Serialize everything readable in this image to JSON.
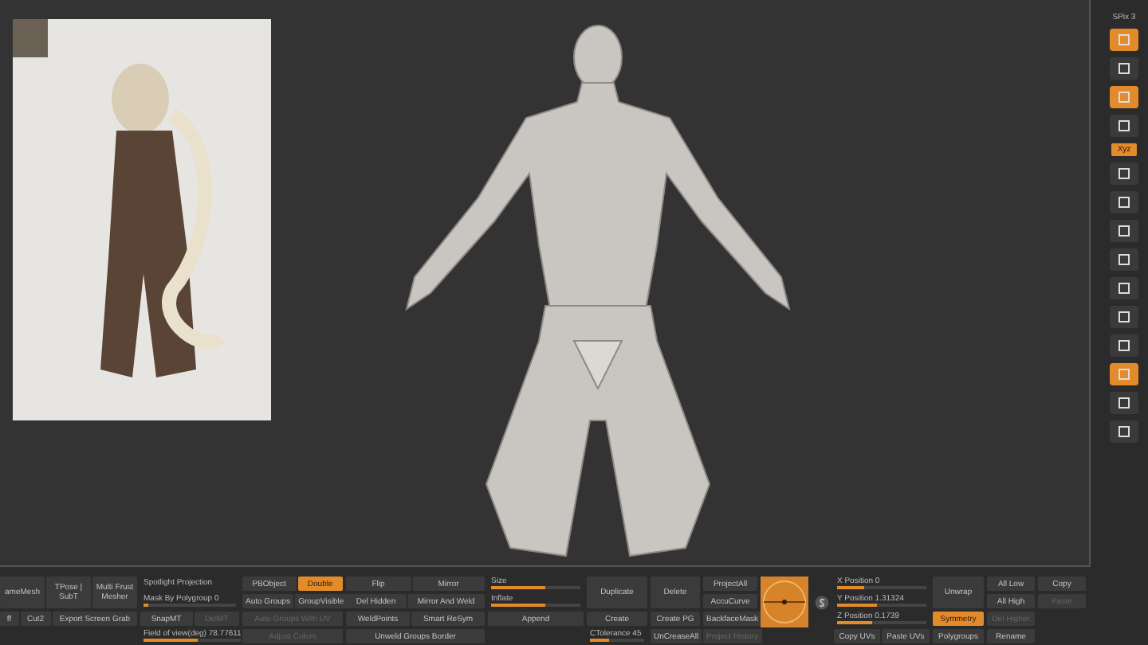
{
  "right_toolbar": [
    {
      "kind": "text",
      "label": "SPix 3"
    },
    {
      "kind": "icon",
      "on": true
    },
    {
      "kind": "icon",
      "on": false
    },
    {
      "kind": "icon",
      "on": true
    },
    {
      "kind": "icon",
      "on": false
    },
    {
      "kind": "text_button",
      "label": "Xyz",
      "on": true
    },
    {
      "kind": "icon",
      "on": false
    },
    {
      "kind": "icon",
      "on": false
    },
    {
      "kind": "icon",
      "on": false
    },
    {
      "kind": "icon",
      "on": false
    },
    {
      "kind": "icon",
      "on": false
    },
    {
      "kind": "icon",
      "on": false
    },
    {
      "kind": "icon",
      "on": false
    },
    {
      "kind": "icon",
      "on": true
    },
    {
      "kind": "icon",
      "on": false
    },
    {
      "kind": "icon",
      "on": false
    }
  ],
  "bottom_panel": {
    "columns": [
      {
        "lines": [
          [
            {
              "kind": "big",
              "label": "ameMesh",
              "on": false,
              "disabled": false
            },
            {
              "kind": "big",
              "label": "TPose | SubT",
              "on": false,
              "disabled": false
            },
            {
              "kind": "big",
              "label": "Multi Frust Mesher",
              "on": false,
              "disabled": false
            }
          ],
          [
            {
              "kind": "button",
              "label": "ff",
              "on": false,
              "disabled": false
            },
            {
              "kind": "button",
              "label": "Cut2",
              "on": false,
              "disabled": false
            },
            {
              "kind": "button",
              "label": "Export Screen Grab",
              "on": false,
              "disabled": false
            }
          ]
        ]
      },
      {
        "lines": [
          [
            {
              "kind": "text",
              "label": "Spotlight Projection"
            }
          ],
          [
            {
              "kind": "slider",
              "label": "Mask By Polygroup 0",
              "level": 0.05
            }
          ],
          [
            {
              "kind": "button",
              "label": "SnapMT",
              "on": false,
              "disabled": false
            },
            {
              "kind": "button",
              "label": "DelMT",
              "on": false,
              "disabled": true
            }
          ],
          [
            {
              "kind": "slider",
              "label": "Field of view(deg) 78.77611",
              "level": 0.55
            }
          ]
        ]
      },
      {
        "lines": [
          [
            {
              "kind": "button",
              "label": "PBObject",
              "on": false,
              "disabled": false
            },
            {
              "kind": "button",
              "label": "Double",
              "on": true,
              "disabled": false
            }
          ],
          [
            {
              "kind": "button",
              "label": "Auto Groups",
              "on": false,
              "disabled": false
            },
            {
              "kind": "button",
              "label": "GroupVisible",
              "on": false,
              "disabled": false
            }
          ],
          [
            {
              "kind": "button",
              "label": "Auto Groups With UV",
              "on": false,
              "disabled": true
            }
          ],
          [
            {
              "kind": "button",
              "label": "Adjust Colors",
              "on": false,
              "disabled": true
            }
          ]
        ]
      },
      {
        "lines": [
          [
            {
              "kind": "button",
              "label": "Flip",
              "on": false,
              "disabled": false
            },
            {
              "kind": "button",
              "label": "Mirror",
              "on": false,
              "disabled": false
            }
          ],
          [
            {
              "kind": "button",
              "label": "Del Hidden",
              "on": false,
              "disabled": false
            },
            {
              "kind": "button",
              "label": "Mirror And Weld",
              "on": false,
              "disabled": false
            }
          ],
          [
            {
              "kind": "button",
              "label": "WeldPoints",
              "on": false,
              "disabled": false
            },
            {
              "kind": "button",
              "label": "Smart ReSym",
              "on": false,
              "disabled": false
            }
          ],
          [
            {
              "kind": "button",
              "label": "Unweld Groups Border",
              "on": false,
              "disabled": false
            }
          ]
        ]
      },
      {
        "lines": [
          [
            {
              "kind": "slider",
              "label": "Size",
              "level": 0.6
            }
          ],
          [
            {
              "kind": "slider",
              "label": "Inflate",
              "level": 0.6
            }
          ],
          [
            {
              "kind": "button",
              "label": "Append",
              "on": false,
              "disabled": false
            }
          ]
        ]
      },
      {
        "lines": [
          [
            {
              "kind": "big",
              "label": "Duplicate",
              "on": false,
              "disabled": false
            }
          ],
          [
            {
              "kind": "button",
              "label": "Create",
              "on": false,
              "disabled": false
            }
          ],
          [
            {
              "kind": "slider",
              "label": "CTolerance 45",
              "level": 0.35
            }
          ]
        ]
      },
      {
        "lines": [
          [
            {
              "kind": "big",
              "label": "Delete",
              "on": false,
              "disabled": false
            }
          ],
          [
            {
              "kind": "button",
              "label": "Create PG",
              "on": false,
              "disabled": false
            }
          ],
          [
            {
              "kind": "button",
              "label": "UnCreaseAll",
              "on": false,
              "disabled": false
            }
          ]
        ]
      },
      {
        "lines": [
          [
            {
              "kind": "button",
              "label": "ProjectAll",
              "on": false,
              "disabled": false
            }
          ],
          [
            {
              "kind": "button",
              "label": "AccuCurve",
              "on": false,
              "disabled": false
            }
          ],
          [
            {
              "kind": "button",
              "label": "BackfaceMask",
              "on": false,
              "disabled": false
            }
          ],
          [
            {
              "kind": "button",
              "label": "Project History",
              "on": false,
              "disabled": true
            }
          ]
        ]
      },
      {
        "lines": [
          [
            {
              "kind": "gizmo"
            }
          ]
        ]
      },
      {
        "lines": [
          [
            {
              "kind": "slider",
              "label": "X Position 0",
              "level": 0.3
            }
          ],
          [
            {
              "kind": "slider",
              "label": "Y Position 1.31324",
              "level": 0.45
            }
          ],
          [
            {
              "kind": "slider",
              "label": "Z Position 0.1739",
              "level": 0.4
            }
          ],
          [
            {
              "kind": "button",
              "label": "Copy UVs",
              "on": false,
              "disabled": false
            },
            {
              "kind": "button",
              "label": "Paste UVs",
              "on": false,
              "disabled": false
            }
          ]
        ]
      },
      {
        "lines": [
          [
            {
              "kind": "big",
              "label": "Unwrap",
              "on": false,
              "disabled": false
            }
          ],
          [
            {
              "kind": "button",
              "label": "Symmetry",
              "on": true,
              "disabled": false
            }
          ],
          [
            {
              "kind": "button",
              "label": "Polygroups",
              "on": false,
              "disabled": false
            }
          ]
        ]
      },
      {
        "lines": [
          [
            {
              "kind": "button",
              "label": "All Low",
              "on": false,
              "disabled": false
            }
          ],
          [
            {
              "kind": "button",
              "label": "All High",
              "on": false,
              "disabled": false
            }
          ],
          [
            {
              "kind": "button",
              "label": "Del Higher",
              "on": false,
              "disabled": true
            }
          ],
          [
            {
              "kind": "button",
              "label": "Rename",
              "on": false,
              "disabled": false
            }
          ]
        ]
      },
      {
        "lines": [
          [
            {
              "kind": "button",
              "label": "Copy",
              "on": false,
              "disabled": false
            }
          ],
          [
            {
              "kind": "button",
              "label": "Paste",
              "on": false,
              "disabled": true
            }
          ]
        ]
      }
    ]
  }
}
